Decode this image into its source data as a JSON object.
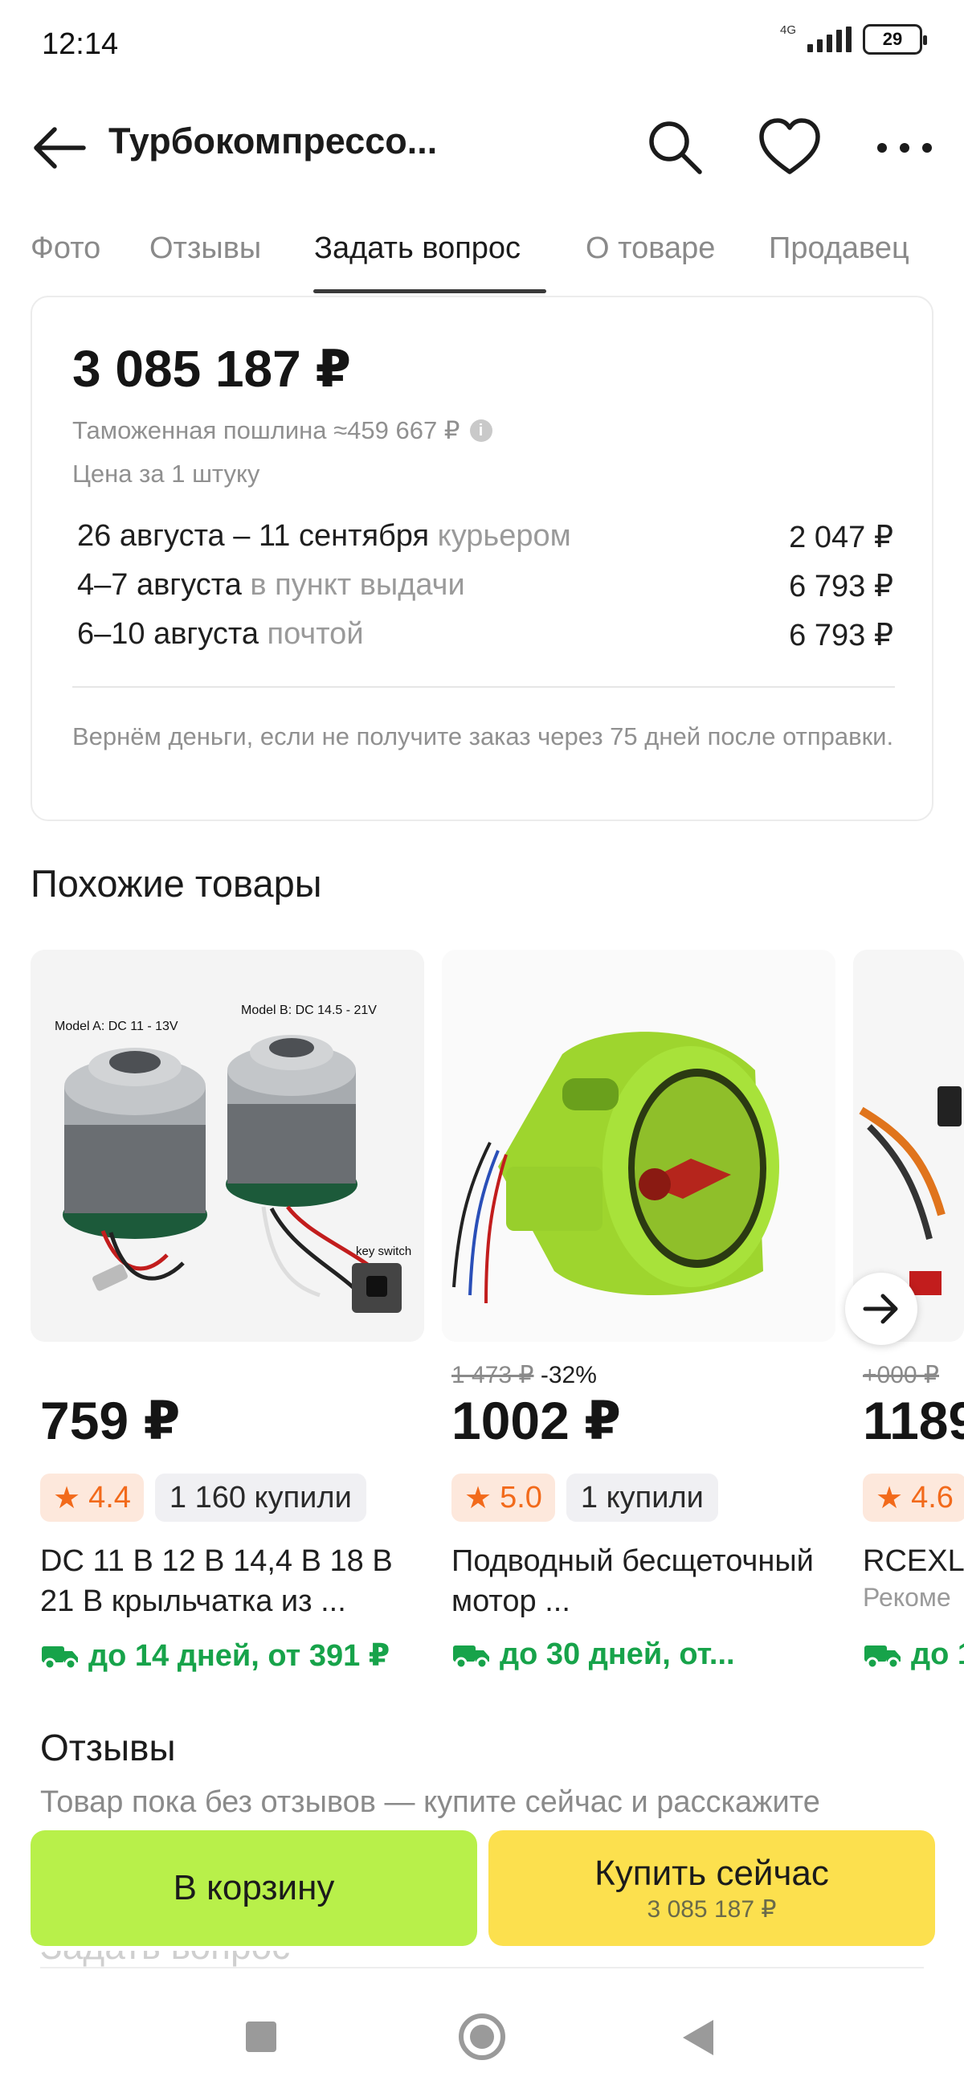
{
  "status": {
    "time": "12:14",
    "network": "4G",
    "battery": "29"
  },
  "header": {
    "title": "Турбокомпрессо..."
  },
  "tabs": [
    "Фото",
    "Отзывы",
    "Задать вопрос",
    "О товаре",
    "Продавец"
  ],
  "price_card": {
    "price": "3 085 187 ₽",
    "duty": "Таможенная пошлина ≈459 667 ₽",
    "per_unit": "Цена за 1 штуку",
    "delivery": [
      {
        "dates": "26 августа – 11 сентября",
        "method": "курьером",
        "price": "2 047 ₽"
      },
      {
        "dates": "4–7 августа",
        "method": "в пункт выдачи",
        "price": "6 793 ₽"
      },
      {
        "dates": "6–10 августа",
        "method": "почтой",
        "price": "6 793 ₽"
      }
    ],
    "refund": "Вернём деньги, если не получите заказ через 75 дней после отправки."
  },
  "similar": {
    "title": "Похожие товары",
    "items": [
      {
        "old_price": "",
        "discount": "",
        "price": "759 ₽",
        "rating": "4.4",
        "bought": "1 160 купили",
        "name": "DC 11 В 12 В 14,4 В 18 В 21 В крыльчатка из ...",
        "shipping": "до 14 дней, от 391 ₽",
        "image_labels": {
          "a": "Model A: DC 11 - 13V",
          "b": "Model B: DC 14.5 - 21V",
          "key": "key switch"
        }
      },
      {
        "old_price": "1 473 ₽",
        "discount": "-32%",
        "price": "1002 ₽",
        "rating": "5.0",
        "bought": "1 купили",
        "name": "Подводный бесщеточный мотор ...",
        "shipping": "до 30 дней, от..."
      },
      {
        "old_price": "+000 ₽",
        "discount": "",
        "price": "1189",
        "rating": "4.6",
        "bought": "",
        "name": "RCEXL",
        "sub": "Рекоме",
        "shipping": "до 1"
      }
    ]
  },
  "reviews": {
    "title": "Отзывы",
    "empty": "Товар пока без отзывов — купите сейчас и расскажите"
  },
  "ask_section": {
    "title": "Задать вопрос"
  },
  "actions": {
    "cart": "В корзину",
    "buy": "Купить сейчас",
    "buy_price": "3 085 187 ₽"
  },
  "colors": {
    "accent_green": "#b8f04a",
    "accent_yellow": "#fce04e",
    "shipping_green": "#17a34a",
    "rating_orange": "#f26a1b"
  }
}
